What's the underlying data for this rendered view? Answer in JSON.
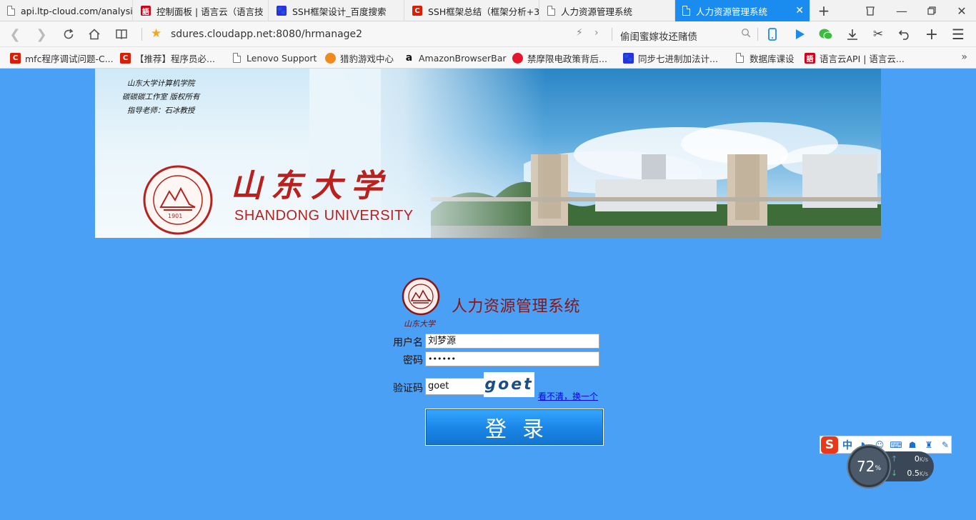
{
  "browser": {
    "tabs": [
      {
        "label": "api.ltp-cloud.com/analysi",
        "icon": "page-icon"
      },
      {
        "label": "控制面板 | 语言云（语言技",
        "icon": "yuyanyun-icon",
        "icon_text": "語"
      },
      {
        "label": "SSH框架设计_百度搜索",
        "icon": "baidu-icon",
        "icon_text": "🐾"
      },
      {
        "label": "SSH框架总结（框架分析+3",
        "icon": "csdn-icon",
        "icon_text": "C"
      },
      {
        "label": "人力资源管理系统",
        "icon": "page-icon"
      },
      {
        "label": "人力资源管理系统",
        "icon": "page-icon",
        "active": true
      }
    ],
    "url": "sdures.cloudapp.net:8080/hrmanage2",
    "search_text": "偷闺蜜嫁妆还赌债",
    "bookmarks": [
      {
        "label": "mfc程序调试问题-C...",
        "icon": "csdn-icon",
        "icon_text": "C"
      },
      {
        "label": "【推荐】程序员必...",
        "icon": "csdn-icon",
        "icon_text": "C"
      },
      {
        "label": "Lenovo Support",
        "icon": "page-icon"
      },
      {
        "label": "猎豹游戏中心",
        "icon": "cheetah-icon"
      },
      {
        "label": "AmazonBrowserBar",
        "icon": "amazon-icon",
        "icon_text": "a"
      },
      {
        "label": "禁摩限电政策背后...",
        "icon": "weibo-icon"
      },
      {
        "label": "同步七进制加法计...",
        "icon": "baidu-icon",
        "icon_text": "🐾"
      },
      {
        "label": "数据库课设",
        "icon": "page-icon"
      },
      {
        "label": "语言云API | 语言云...",
        "icon": "yuyanyun-icon",
        "icon_text": "語"
      }
    ]
  },
  "banner": {
    "credits": [
      "山东大学计算机学院",
      "碳碳碳工作室 版权所有",
      "指导老师：石冰教授"
    ],
    "school_cn": "山东大学",
    "school_en": "SHANDONG UNIVERSITY",
    "seal_year": "1901"
  },
  "login": {
    "logo_signature": "山东大学",
    "system_title": "人力资源管理系统",
    "username_label": "用户名",
    "username_value": "刘梦源",
    "password_label": "密码",
    "password_value": "••••••",
    "captcha_label": "验证码",
    "captcha_value": "goet",
    "captcha_image_text": "goet",
    "refresh_link": "看不清，换一个",
    "login_button": "登录"
  },
  "widgets": {
    "ime_mode": "中",
    "net_percent": "72",
    "net_percent_unit": "%",
    "upload_speed": "0",
    "download_speed": "0.5",
    "speed_unit": "K/s"
  },
  "colors": {
    "page_background": "#4aa0f5",
    "active_tab": "#1a8cf0",
    "login_button": "#1b87e8",
    "title_red": "#8b1515"
  }
}
